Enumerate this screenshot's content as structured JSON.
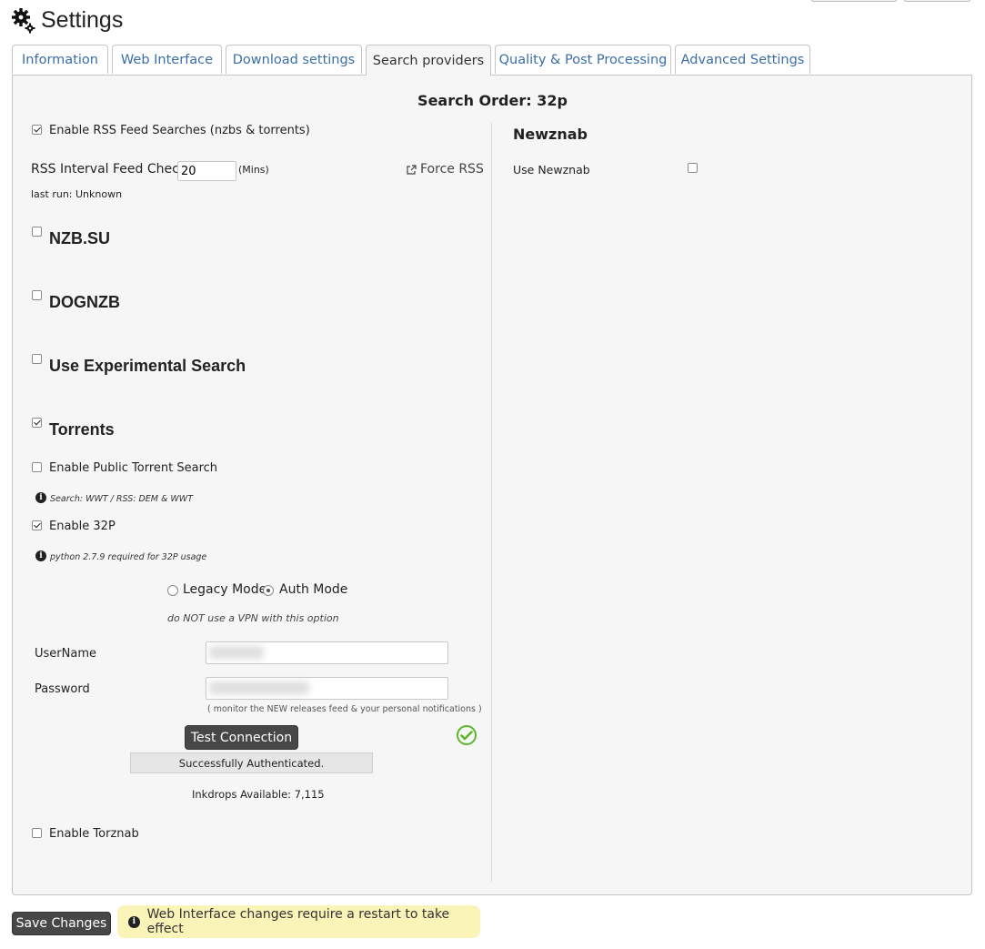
{
  "header": {
    "title": "Settings",
    "icon": "gears-icon"
  },
  "tabs": [
    {
      "label": "Information",
      "active": false
    },
    {
      "label": "Web Interface",
      "active": false
    },
    {
      "label": "Download settings",
      "active": false
    },
    {
      "label": "Search providers",
      "active": true
    },
    {
      "label": "Quality & Post Processing",
      "active": false
    },
    {
      "label": "Advanced Settings",
      "active": false
    }
  ],
  "search_order": "Search Order: 32p",
  "left": {
    "rss_enable": {
      "label": "Enable RSS Feed Searches (nzbs & torrents)",
      "checked": true
    },
    "rss_interval": {
      "label": "RSS Interval Feed Check",
      "value": "20",
      "unit": "(Mins)"
    },
    "force_rss": "Force RSS",
    "last_run": "last run: Unknown",
    "nzbsu": {
      "label": "NZB.SU",
      "checked": false
    },
    "dognzb": {
      "label": "DOGNZB",
      "checked": false
    },
    "experimental": {
      "label": "Use Experimental Search",
      "checked": false
    },
    "torrents": {
      "label": "Torrents",
      "checked": true
    },
    "public_torrent": {
      "label": "Enable Public Torrent Search",
      "checked": false,
      "note": "Search: WWT / RSS: DEM & WWT"
    },
    "enable_32p": {
      "label": "Enable 32P",
      "checked": true,
      "note": "python 2.7.9 required for 32P usage"
    },
    "mode": {
      "legacy": "Legacy Mode",
      "auth": "Auth Mode",
      "selected": "auth",
      "warning": "do NOT use a VPN with this option"
    },
    "username": {
      "label": "UserName",
      "value": ""
    },
    "password": {
      "label": "Password",
      "value": ""
    },
    "monitor_note": "( monitor the NEW releases feed & your personal notifications )",
    "test_button": "Test Connection",
    "status": "Successfully Authenticated.",
    "inkdrops": "Inkdrops Available: 7,115",
    "torznab": {
      "label": "Enable Torznab",
      "checked": false
    }
  },
  "right": {
    "title": "Newznab",
    "use_newznab": {
      "label": "Use Newznab",
      "checked": false
    }
  },
  "footer": {
    "save_button": "Save Changes",
    "notice": "Web Interface changes require a restart to take effect"
  },
  "colors": {
    "tab_link": "#3a6ea5",
    "success": "#5cb82a",
    "notice_bg": "#fbf4b8",
    "button_dark": "#474747"
  }
}
